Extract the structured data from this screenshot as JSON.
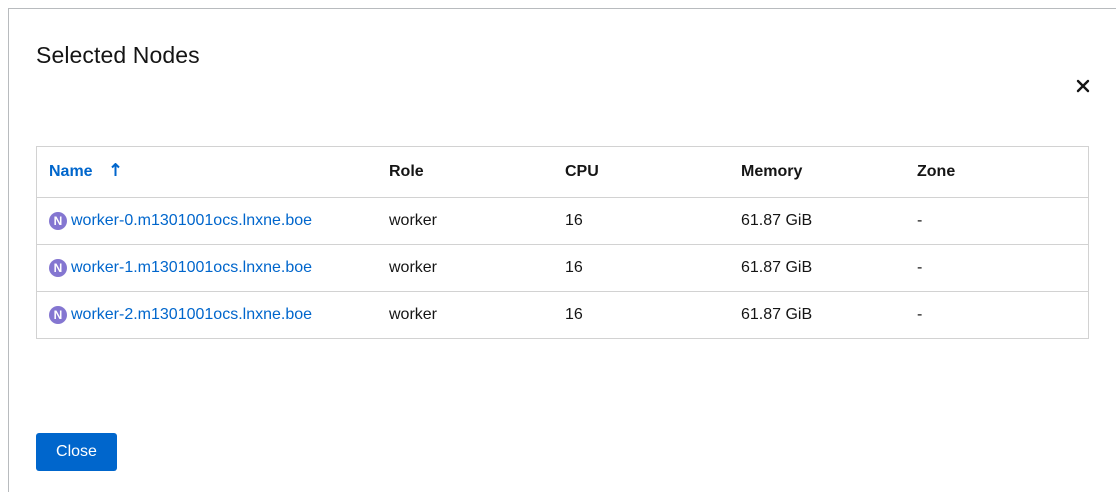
{
  "modal": {
    "title": "Selected Nodes",
    "close_button_label": "Close"
  },
  "table": {
    "columns": [
      {
        "label": "Name",
        "sorted": "ascending"
      },
      {
        "label": "Role"
      },
      {
        "label": "CPU"
      },
      {
        "label": "Memory"
      },
      {
        "label": "Zone"
      }
    ],
    "rows": [
      {
        "badge": "N",
        "name": "worker-0.m1301001ocs.lnxne.boe",
        "role": "worker",
        "cpu": "16",
        "memory": "61.87 GiB",
        "zone": "-"
      },
      {
        "badge": "N",
        "name": "worker-1.m1301001ocs.lnxne.boe",
        "role": "worker",
        "cpu": "16",
        "memory": "61.87 GiB",
        "zone": "-"
      },
      {
        "badge": "N",
        "name": "worker-2.m1301001ocs.lnxne.boe",
        "role": "worker",
        "cpu": "16",
        "memory": "61.87 GiB",
        "zone": "-"
      }
    ]
  },
  "colors": {
    "link": "#0066cc",
    "node_badge": "#8476d1",
    "primary_button": "#0066cc"
  },
  "icons": {
    "close": "close-icon",
    "sort": "sort-ascending-icon",
    "node": "node-badge-icon"
  }
}
